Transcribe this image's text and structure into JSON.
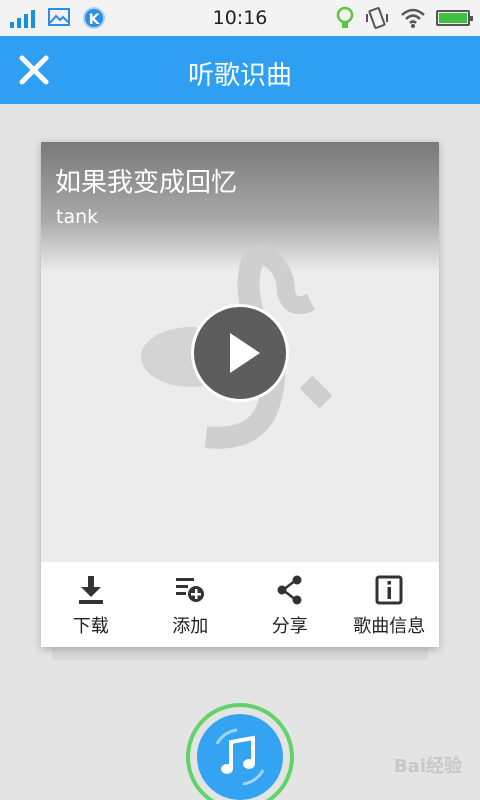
{
  "status_bar": {
    "time": "10:16",
    "left_icons": [
      "signal-icon",
      "picture-icon",
      "k-app-icon"
    ],
    "right_icons": [
      "bulb-icon",
      "vibrate-icon",
      "wifi-icon",
      "battery-icon"
    ],
    "k_label": "K"
  },
  "header": {
    "title": "听歌识曲",
    "close_icon": "close-icon",
    "background": "#2e9ff3"
  },
  "song": {
    "title": "如果我变成回忆",
    "artist": "tank"
  },
  "actions": [
    {
      "label": "下载",
      "icon": "download-icon"
    },
    {
      "label": "添加",
      "icon": "add-to-list-icon"
    },
    {
      "label": "分享",
      "icon": "share-icon"
    },
    {
      "label": "歌曲信息",
      "icon": "info-icon"
    }
  ],
  "recognize_button": {
    "icon": "music-note-icon",
    "ring_color": "#62d36a",
    "color": "#34a3f2"
  },
  "watermark": "Bai经验"
}
